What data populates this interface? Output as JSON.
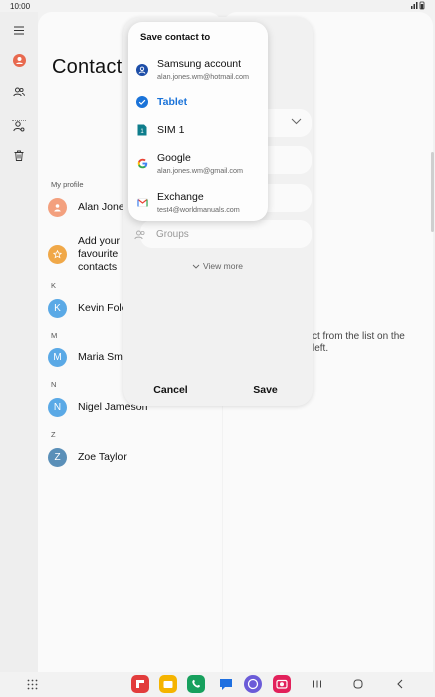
{
  "status_bar": {
    "time": "10:00"
  },
  "contacts_list": {
    "title": "Contacts",
    "my_profile_label": "My profile",
    "profile_name": "Alan Jones",
    "add_prompt": "Add your favourite contacts",
    "sections": [
      {
        "letter": "K",
        "contacts": [
          {
            "initial": "K",
            "name": "Kevin Foley",
            "color": "#5aa9e6"
          }
        ]
      },
      {
        "letter": "M",
        "contacts": [
          {
            "initial": "M",
            "name": "Maria Smith",
            "color": "#5aa9e6"
          }
        ]
      },
      {
        "letter": "N",
        "contacts": [
          {
            "initial": "N",
            "name": "Nigel Jameson",
            "color": "#5aa9e6"
          }
        ]
      },
      {
        "letter": "Z",
        "contacts": [
          {
            "initial": "Z",
            "name": "Zoe Taylor",
            "color": "#5a8fb8"
          }
        ]
      }
    ]
  },
  "detail": {
    "hint": "ct from the list on the left."
  },
  "editor": {
    "groups_label": "Groups",
    "view_more_label": "View more",
    "cancel_label": "Cancel",
    "save_label": "Save"
  },
  "save_to_popup": {
    "title": "Save contact to",
    "options": [
      {
        "label": "Samsung account",
        "sub": "alan.jones.wm@hotmail.com",
        "icon": "samsung-account-icon",
        "selected": false
      },
      {
        "label": "Tablet",
        "sub": "",
        "icon": "check-circle-icon",
        "selected": true
      },
      {
        "label": "SIM 1",
        "sub": "",
        "icon": "sim-card-icon",
        "selected": false
      },
      {
        "label": "Google",
        "sub": "alan.jones.wm@gmail.com",
        "icon": "google-icon",
        "selected": false
      },
      {
        "label": "Exchange",
        "sub": "test4@worldmanuals.com",
        "icon": "gmail-icon",
        "selected": false
      }
    ]
  },
  "colors": {
    "accent": "#1a73d9",
    "profile_avatar": "#f3a07e",
    "favourite_star": "#f0a848",
    "rail_contact_icon": "#e8694f"
  },
  "dock_apps": [
    {
      "icon": "flipboard-icon",
      "color": "#e23c3c"
    },
    {
      "icon": "my-files-icon",
      "color": "#f5b400"
    },
    {
      "icon": "phone-icon",
      "color": "#17a05d"
    },
    {
      "icon": "messages-icon",
      "color": "#1e6fe0"
    },
    {
      "icon": "internet-icon",
      "color": "#6b5bd8"
    },
    {
      "icon": "camera-icon",
      "color": "#e2215b"
    }
  ]
}
